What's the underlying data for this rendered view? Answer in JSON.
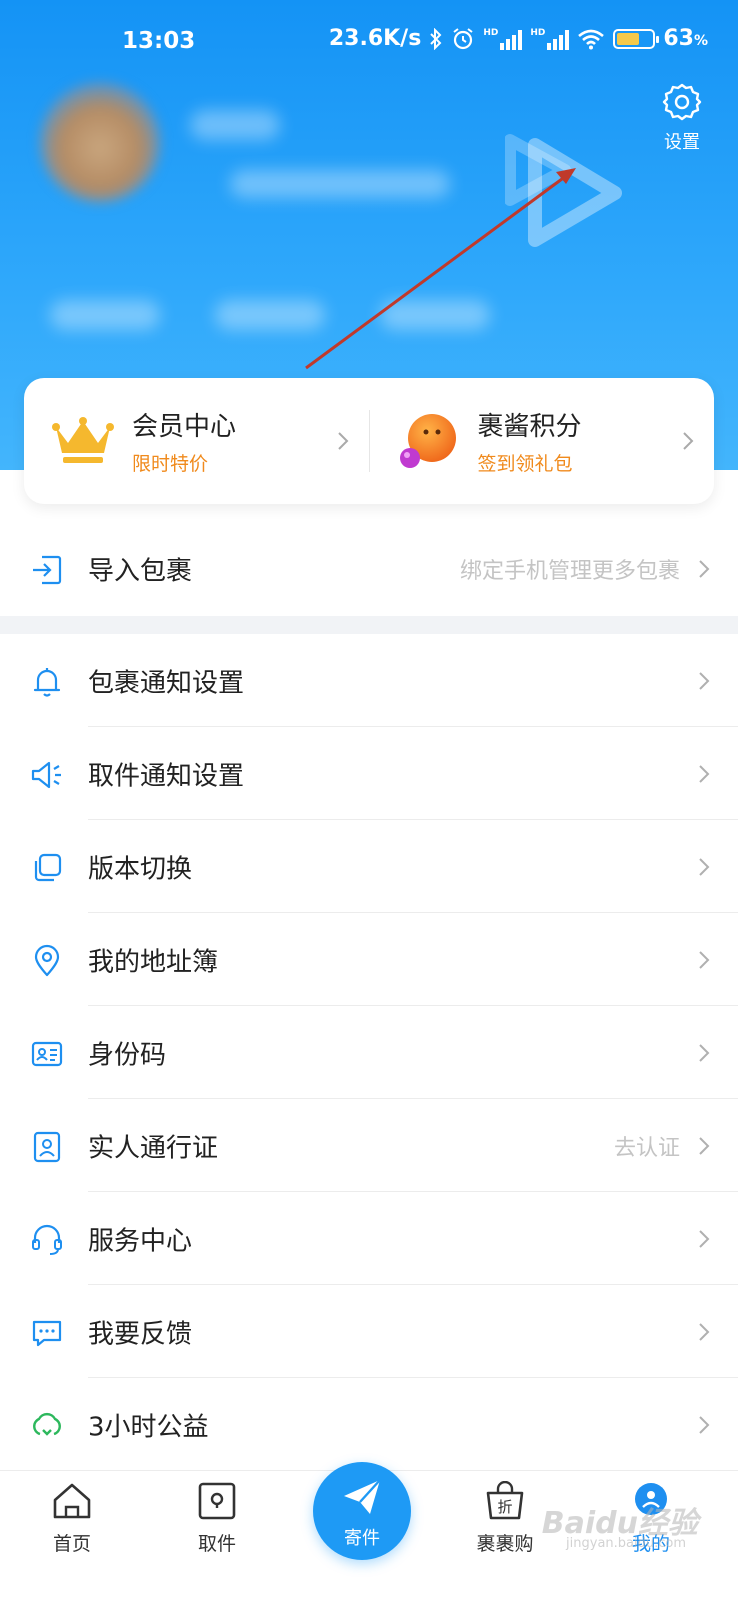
{
  "status_bar": {
    "time": "13:03",
    "network_speed": "23.6K/s",
    "signal_badge_1": "HD",
    "signal_badge_2": "HD",
    "battery_percent": "63",
    "battery_unit": "%",
    "battery_level": 0.63
  },
  "header": {
    "settings_label": "设置"
  },
  "card": {
    "member": {
      "title": "会员中心",
      "subtitle": "限时特价"
    },
    "points": {
      "title": "裹酱积分",
      "subtitle": "签到领礼包"
    }
  },
  "import_row": {
    "label": "导入包裹",
    "hint": "绑定手机管理更多包裹"
  },
  "menu": [
    {
      "label": "包裹通知设置",
      "icon": "bell-icon",
      "hint": ""
    },
    {
      "label": "取件通知设置",
      "icon": "speaker-icon",
      "hint": ""
    },
    {
      "label": "版本切换",
      "icon": "switch-icon",
      "hint": ""
    },
    {
      "label": "我的地址簿",
      "icon": "location-pin-icon",
      "hint": ""
    },
    {
      "label": "身份码",
      "icon": "id-card-icon",
      "hint": ""
    },
    {
      "label": "实人通行证",
      "icon": "person-badge-icon",
      "hint": "去认证"
    },
    {
      "label": "服务中心",
      "icon": "headset-icon",
      "hint": ""
    },
    {
      "label": "我要反馈",
      "icon": "chat-icon",
      "hint": ""
    },
    {
      "label": "3小时公益",
      "icon": "charity-icon",
      "hint": ""
    }
  ],
  "tabbar": {
    "home": "首页",
    "pickup": "取件",
    "send": "寄件",
    "shop": "裹裹购",
    "shop_badge": "折",
    "mine": "我的"
  },
  "watermark": {
    "text": "Baidu经验",
    "sub": "jingyan.baidu.com"
  },
  "colors": {
    "header_blue": "#1493f5",
    "accent_blue": "#1e9af5",
    "subtitle_orange": "#f08a1c",
    "annotation_red": "#c0392b",
    "charity_green": "#2db85d"
  }
}
